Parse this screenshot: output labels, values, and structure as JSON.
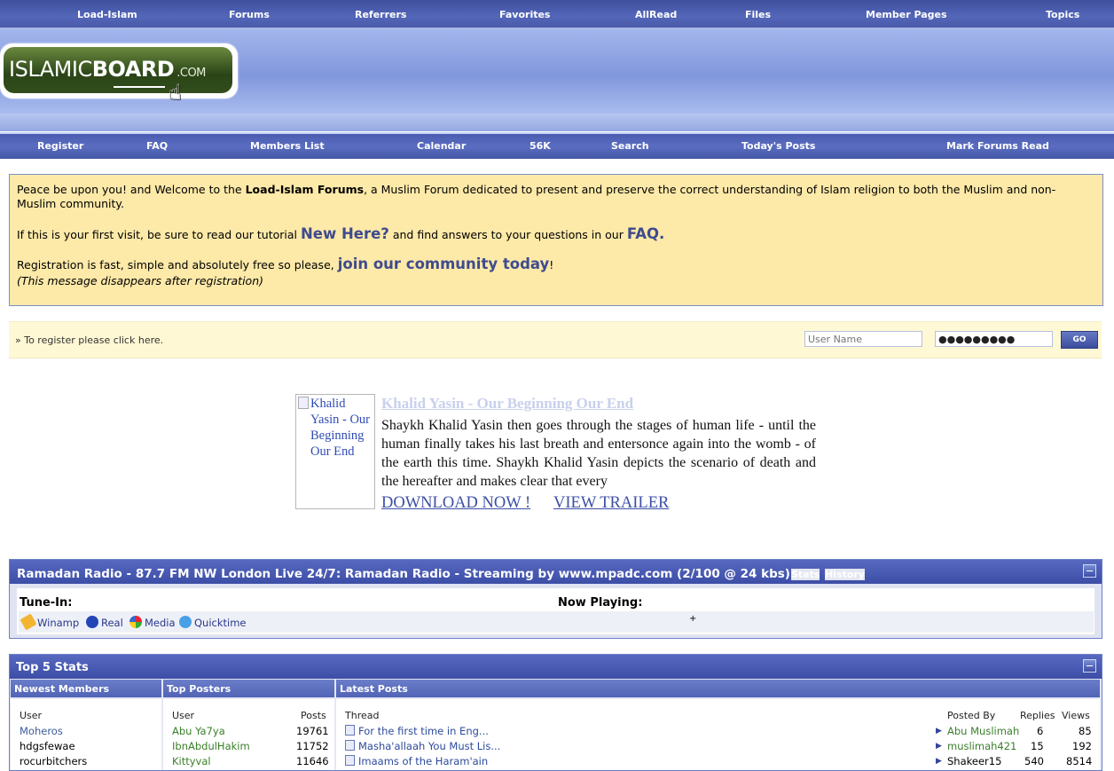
{
  "top_nav": [
    "Load-Islam",
    "Forums",
    "Referrers",
    "Favorites",
    "AllRead",
    "Files",
    "Member Pages",
    "Topics"
  ],
  "logo": {
    "part1": "ISLAMIC",
    "part2": "BOARD",
    "part3": ".COM"
  },
  "sub_nav": [
    "Register",
    "FAQ",
    "Members List",
    "Calendar",
    "56K",
    "Search",
    "Today's Posts",
    "Mark Forums Read"
  ],
  "welcome": {
    "l1_a": "Peace be upon you! and Welcome to the ",
    "l1_b": "Load-Islam Forums",
    "l1_c": ", a Muslim Forum dedicated to present and preserve the correct understanding of Islam religion to both the Muslim and non-Muslim community.",
    "l2_a": "If this is your first visit, be sure to read our tutorial ",
    "l2_link": "New Here?",
    "l2_b": " and find answers to your questions in our ",
    "l2_faq": "FAQ.",
    "l3_a": "Registration is fast, simple and absolutely free so please, ",
    "l3_link": "join our community today",
    "l3_b": "!",
    "l4": "(This message disappears after registration)"
  },
  "login": {
    "register_msg": "To register please click here.",
    "username_placeholder": "User Name",
    "password_value": "●●●●●●●●●",
    "go_label": "GO"
  },
  "promo": {
    "image_alt": "Khalid Yasin - Our Beginning Our End",
    "title": "Khalid Yasin - Our Beginning Our End",
    "description": "Shaykh Khalid Yasin then goes through the stages of human life - until the human finally takes his last breath and entersonce again into the womb - of the earth this time. Shaykh Khalid Yasin depicts the scenario of death and the hereafter and makes clear that every",
    "download": "DOWNLOAD NOW !",
    "trailer": "VIEW TRAILER"
  },
  "radio": {
    "title": "Ramadan Radio - 87.7 FM NW London Live 24/7: Ramadan Radio - Streaming by www.mpadc.com (2/100 @ 24 kbs)",
    "stats_link": "Stats",
    "history_link": "History",
    "tune_in": "Tune-In:",
    "now_playing": "Now Playing:",
    "now_playing_value": "+",
    "players": [
      "Winamp",
      "Real",
      "Media",
      "Quicktime"
    ]
  },
  "stats": {
    "title": "Top 5 Stats",
    "col_newest": "Newest Members",
    "col_posters": "Top Posters",
    "col_latest": "Latest Posts",
    "h_user": "User",
    "h_posts": "Posts",
    "h_thread": "Thread",
    "h_posted_by": "Posted By",
    "h_replies": "Replies",
    "h_views": "Views",
    "newest_members": [
      "Moheros",
      "hdgsfewae",
      "rocurbitchers"
    ],
    "top_posters": [
      {
        "user": "Abu Ya7ya",
        "posts": "19761"
      },
      {
        "user": "IbnAbdulHakim",
        "posts": "11752"
      },
      {
        "user": "Kittyval",
        "posts": "11646"
      }
    ],
    "latest_posts": [
      {
        "thread": "For the first time in Eng...",
        "by": "Abu Muslimah",
        "replies": "6",
        "views": "85"
      },
      {
        "thread": "Masha'allaah You Must Lis...",
        "by": "muslimah421",
        "replies": "15",
        "views": "192"
      },
      {
        "thread": "Imaams of the Haram'ain",
        "by": "Shakeer15",
        "replies": "540",
        "views": "8514"
      }
    ]
  }
}
